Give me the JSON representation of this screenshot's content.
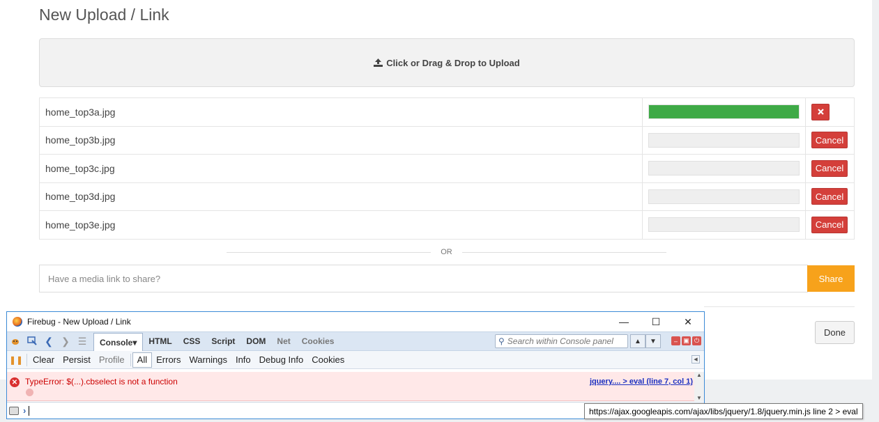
{
  "page": {
    "title": "New Upload / Link",
    "dropzone_label": "Click or Drag & Drop to Upload",
    "files": [
      {
        "name": "home_top3a.jpg",
        "progress": 1.0,
        "action": "remove"
      },
      {
        "name": "home_top3b.jpg",
        "progress": 0,
        "action": "Cancel"
      },
      {
        "name": "home_top3c.jpg",
        "progress": 0,
        "action": "Cancel"
      },
      {
        "name": "home_top3d.jpg",
        "progress": 0,
        "action": "Cancel"
      },
      {
        "name": "home_top3e.jpg",
        "progress": 0,
        "action": "Cancel"
      }
    ],
    "or_label": "OR",
    "link_placeholder": "Have a media link to share?",
    "share_label": "Share",
    "done_label": "Done",
    "colors": {
      "progress_fill": "#3eaa46",
      "cancel": "#d43f3a",
      "share": "#f7a21b"
    }
  },
  "firebug": {
    "window_title": "Firebug - New Upload / Link",
    "window_controls": {
      "minimize": "—",
      "maximize": "☐",
      "close": "✕"
    },
    "tabs": [
      {
        "label": "Console",
        "active": true,
        "has_dropdown": true
      },
      {
        "label": "HTML"
      },
      {
        "label": "CSS"
      },
      {
        "label": "Script"
      },
      {
        "label": "DOM"
      },
      {
        "label": "Net",
        "dim": true
      },
      {
        "label": "Cookies",
        "dim": true
      }
    ],
    "search_placeholder": "Search within Console panel",
    "filters": {
      "clear": "Clear",
      "persist": "Persist",
      "profile": "Profile",
      "all": "All",
      "errors": "Errors",
      "warnings": "Warnings",
      "info": "Info",
      "debug_info": "Debug Info",
      "cookies": "Cookies"
    },
    "error": {
      "message": "TypeError: $(...).cbselect is not a function",
      "source": "jquery.... > eval (line 7, col 1)"
    },
    "tooltip": "https://ajax.googleapis.com/ajax/libs/jquery/1.8/jquery.min.js line 2 > eval"
  }
}
